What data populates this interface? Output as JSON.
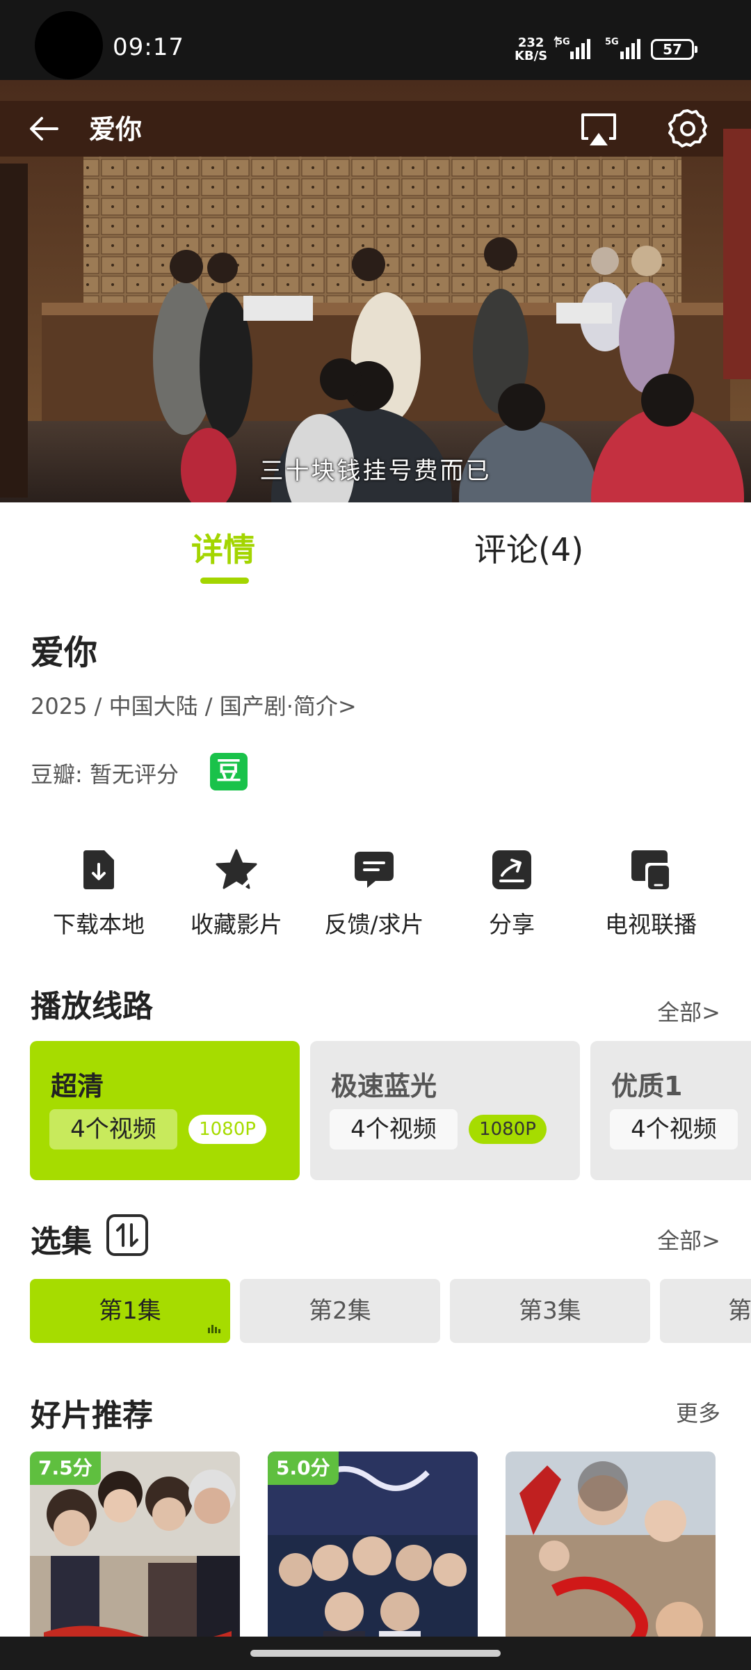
{
  "status_bar": {
    "time": "09:17",
    "net_speed_value": "232",
    "net_speed_unit": "KB/S",
    "sim1_label": "5G",
    "sim2_label": "5G",
    "battery": "57"
  },
  "video": {
    "title": "爱你",
    "subtitle": "三十块钱挂号费而已"
  },
  "tabs": {
    "details": "详情",
    "comments": "评论(4)"
  },
  "info": {
    "title": "爱你",
    "meta": "2025 / 中国大陆 / 国产剧·简介>",
    "rating": "豆瓣:  暂无评分",
    "douban_badge": "豆"
  },
  "actions": [
    {
      "label": "下载本地",
      "icon": "download-icon"
    },
    {
      "label": "收藏影片",
      "icon": "star-icon"
    },
    {
      "label": "反馈/求片",
      "icon": "feedback-icon"
    },
    {
      "label": "分享",
      "icon": "share-icon"
    },
    {
      "label": "电视联播",
      "icon": "tv-cast-icon"
    }
  ],
  "sources_section": {
    "title": "播放线路",
    "more": "全部>",
    "items": [
      {
        "name": "超清",
        "count": "4个视频",
        "quality": "1080P"
      },
      {
        "name": "极速蓝光",
        "count": "4个视频",
        "quality": "1080P"
      },
      {
        "name": "优质1",
        "count": "4个视频"
      }
    ]
  },
  "episodes_section": {
    "title": "选集",
    "more": "全部>",
    "items": [
      "第1集",
      "第2集",
      "第3集",
      "第"
    ]
  },
  "recommend_section": {
    "title": "好片推荐",
    "more": "更多",
    "posters": [
      {
        "score": "7.5分"
      },
      {
        "score": "5.0分"
      },
      {
        "score": ""
      }
    ]
  },
  "colors": {
    "accent": "#a6dc00",
    "accent_text": "#a3d500",
    "douban_green": "#19c24a",
    "score_badge": "#5fbf3f"
  }
}
